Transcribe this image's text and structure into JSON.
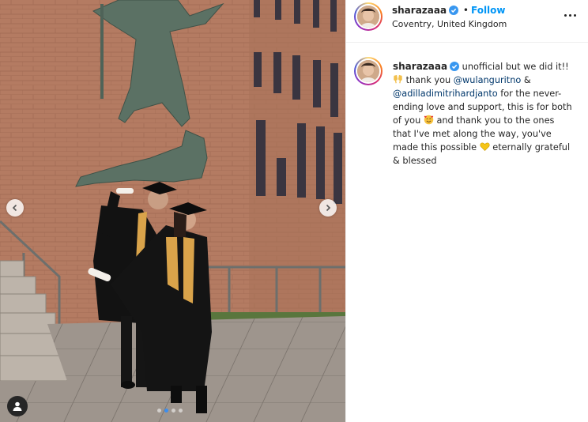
{
  "post": {
    "username": "sharazaaa",
    "follow_label": "Follow",
    "bullet": "•",
    "location": "Coventry, United Kingdom",
    "verified_icon": "verified-badge-icon",
    "accent_color": "#0095f6"
  },
  "caption": {
    "username": "sharazaaa",
    "text_1": "unofficial but we did it!!",
    "text_2": "thank you",
    "mention_1": "@wulanguritno",
    "text_3": "&",
    "mention_2": "@adilladimitrihardjanto",
    "text_4": "for the never-ending love and support, this is for both of you",
    "text_5": "and thank you to the ones that I've met along the way, you've made this possible",
    "text_6": "eternally grateful & blessed",
    "emojis": [
      "clinking-glasses-emoji",
      "smiling-face-with-hearts-emoji",
      "yellow-heart-emoji"
    ]
  },
  "carousel": {
    "slide_count": 4,
    "active_slide": 2
  }
}
